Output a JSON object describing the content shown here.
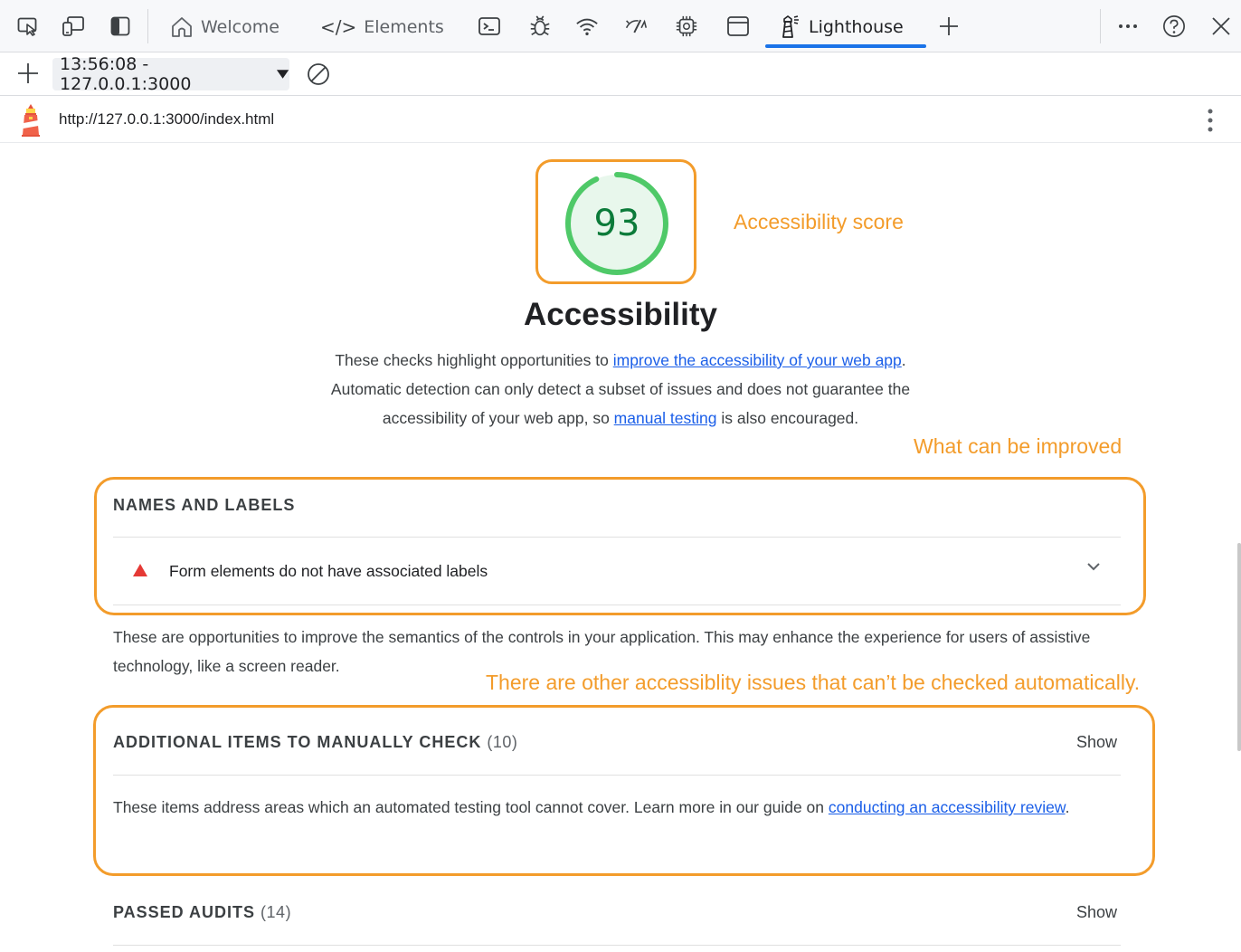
{
  "devtools": {
    "tabs": [
      {
        "label": "Welcome",
        "icon": "home-icon"
      },
      {
        "label": "Elements",
        "icon": "code-icon"
      },
      {
        "label": "Lighthouse",
        "icon": "lighthouse-icon",
        "active": true
      }
    ],
    "report_select": "13:56:08 - 127.0.0.1:3000",
    "url": "http://127.0.0.1:3000/index.html"
  },
  "report": {
    "score": "93",
    "category_title": "Accessibility",
    "desc_part1": "These checks highlight opportunities to ",
    "desc_link1": "improve the accessibility of your web app",
    "desc_part2": ". Automatic detection can only detect a subset of issues and does not guarantee the accessibility of your web app, so ",
    "desc_link2": "manual testing",
    "desc_part3": " is also encouraged.",
    "groups": {
      "names_labels": {
        "title": "NAMES AND LABELS",
        "audit": "Form elements do not have associated labels",
        "description": "These are opportunities to improve the semantics of the controls in your application. This may enhance the experience for users of assistive technology, like a screen reader."
      },
      "manual": {
        "title": "ADDITIONAL ITEMS TO MANUALLY CHECK",
        "count": "(10)",
        "show": "Show",
        "desc_part1": "These items address areas which an automated testing tool cannot cover. Learn more in our guide on ",
        "desc_link": "conducting an accessibility review",
        "desc_part2": "."
      },
      "passed": {
        "title": "PASSED AUDITS",
        "count": "(14)",
        "show": "Show"
      }
    }
  },
  "annotations": {
    "score": "Accessibility score",
    "improve": "What can be improved",
    "other": "There are other accessiblity issues that can’t be checked automatically."
  },
  "colors": {
    "annotation": "#f39c2b",
    "gauge_stroke": "#4fc968",
    "gauge_fill": "#e8f7ec",
    "score_text": "#0c7b3a",
    "fail": "#e53935",
    "link": "#1a5ee8",
    "active_tab": "#1a73e8"
  }
}
